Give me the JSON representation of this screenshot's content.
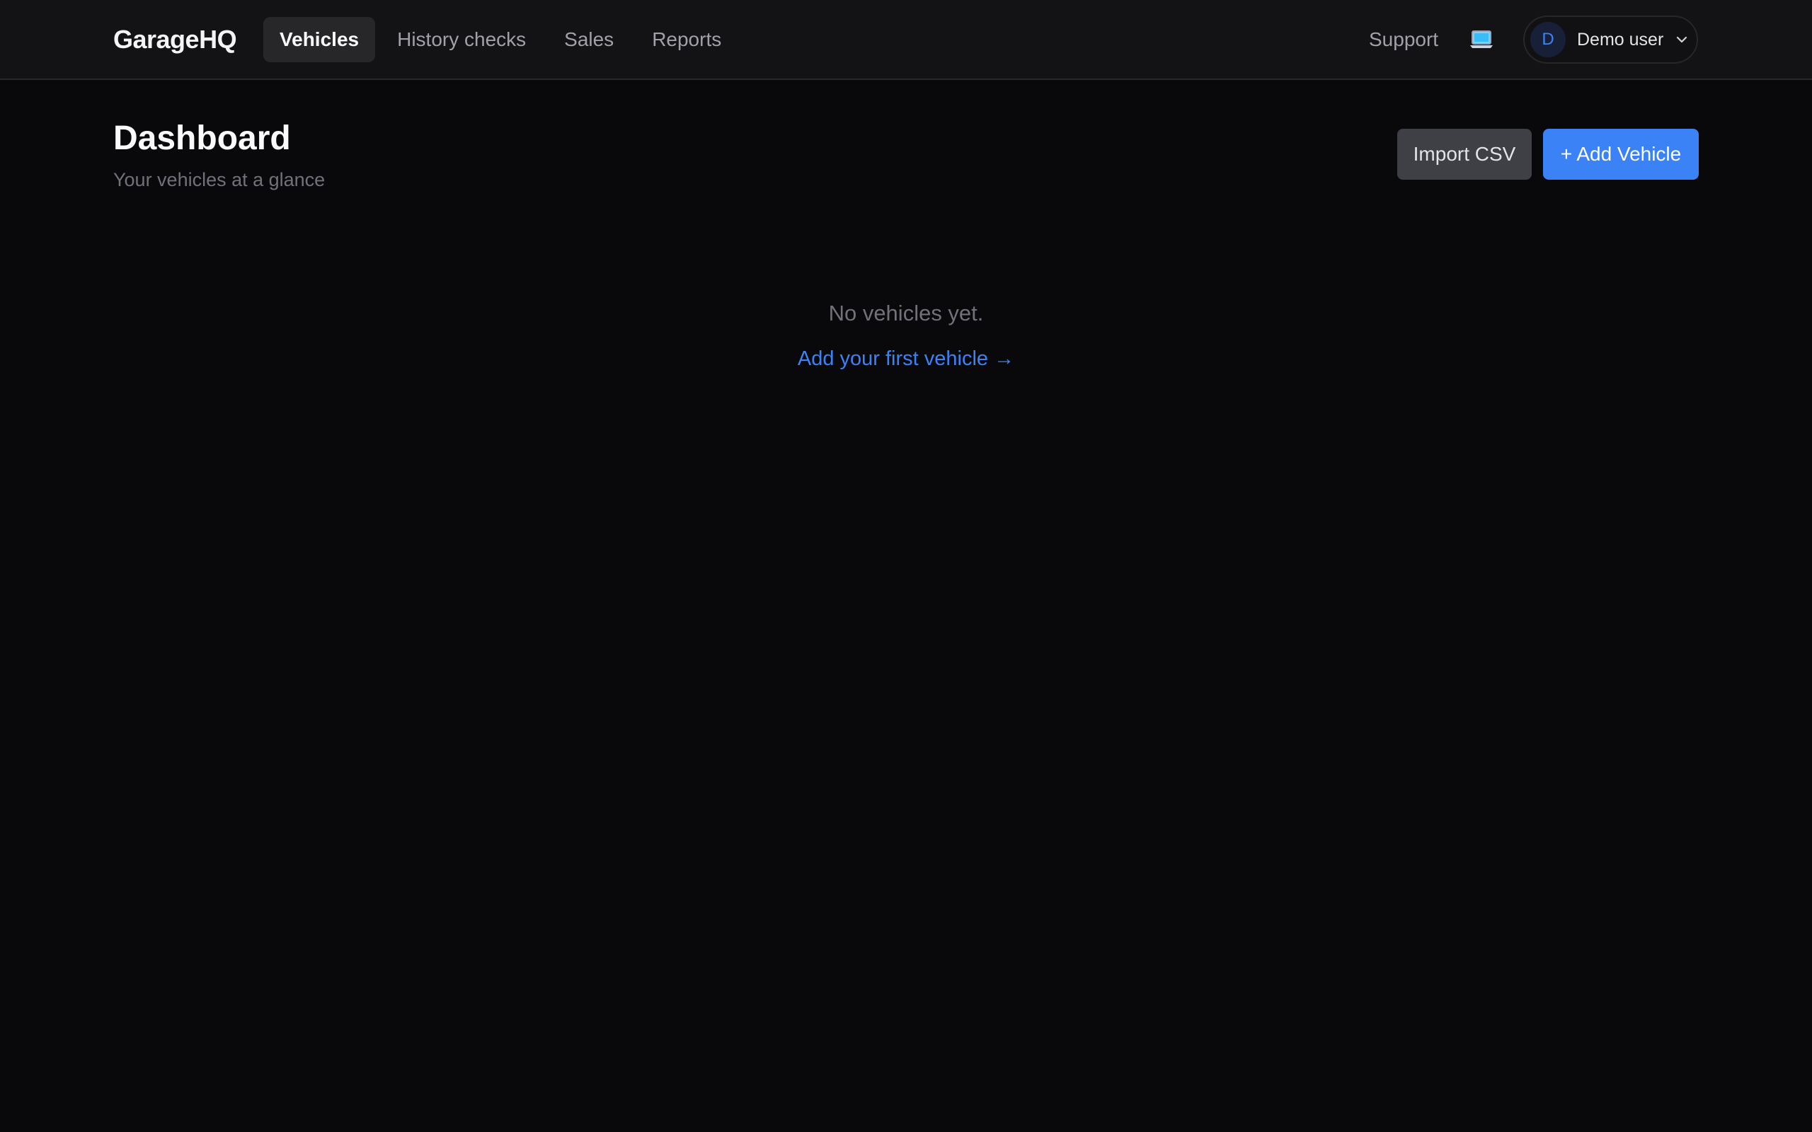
{
  "app": {
    "brand": "GarageHQ"
  },
  "nav": {
    "items": [
      {
        "label": "Vehicles",
        "active": true
      },
      {
        "label": "History checks",
        "active": false
      },
      {
        "label": "Sales",
        "active": false
      },
      {
        "label": "Reports",
        "active": false
      }
    ]
  },
  "header_right": {
    "support_label": "Support",
    "theme_icon": "laptop-icon",
    "user": {
      "initial": "D",
      "name": "Demo user",
      "menu_icon": "chevron-down-icon"
    }
  },
  "page": {
    "title": "Dashboard",
    "subtitle": "Your vehicles at a glance",
    "import_label": "Import CSV",
    "add_label": "+ Add Vehicle"
  },
  "empty_state": {
    "message": "No vehicles yet.",
    "cta": "Add your first vehicle →"
  },
  "colors": {
    "background": "#09090b",
    "topbar": "#131316",
    "accent": "#3b82f6",
    "muted_text": "#71717a",
    "secondary_button": "#3f3f46"
  }
}
